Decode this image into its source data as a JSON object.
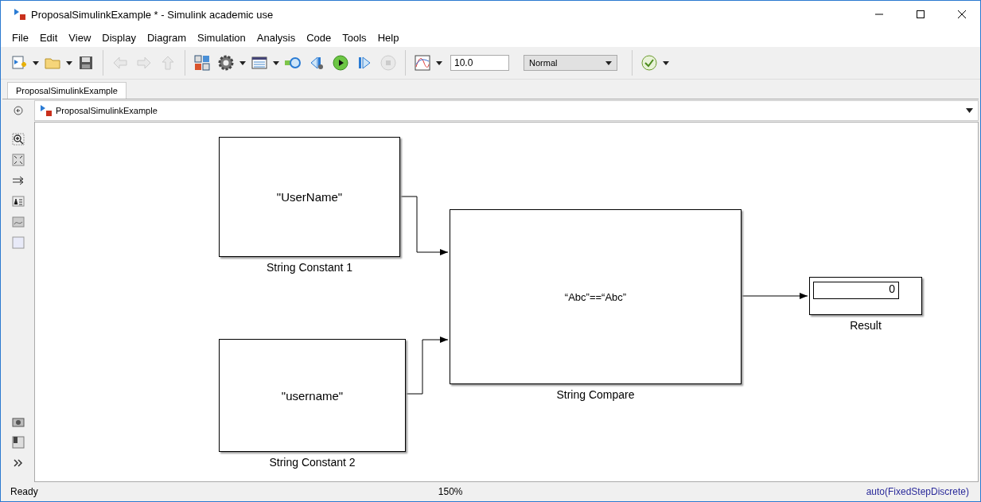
{
  "window": {
    "title": "ProposalSimulinkExample * - Simulink academic use"
  },
  "menu": [
    "File",
    "Edit",
    "View",
    "Display",
    "Diagram",
    "Simulation",
    "Analysis",
    "Code",
    "Tools",
    "Help"
  ],
  "toolbar": [
    {
      "kind": "new",
      "disabled": false
    },
    {
      "kind": "open",
      "disabled": false
    },
    {
      "kind": "save",
      "disabled": false
    },
    {
      "kind": "back",
      "disabled": true
    },
    {
      "kind": "forward",
      "disabled": true
    },
    {
      "kind": "up",
      "disabled": true
    },
    {
      "kind": "library",
      "disabled": false
    },
    {
      "kind": "settings",
      "disabled": false
    },
    {
      "kind": "explorer",
      "disabled": false
    },
    {
      "kind": "update",
      "disabled": false
    },
    {
      "kind": "stepback",
      "disabled": false
    },
    {
      "kind": "run",
      "disabled": false
    },
    {
      "kind": "stepforward",
      "disabled": false
    },
    {
      "kind": "stop",
      "disabled": true
    },
    {
      "kind": "scope",
      "disabled": false
    }
  ],
  "stop_time": "10.0",
  "sim_mode": "Normal",
  "tabs": [
    {
      "label": "ProposalSimulinkExample",
      "selected": true
    }
  ],
  "breadcrumb": "ProposalSimulinkExample",
  "palette": [
    {
      "kind": "zoom"
    },
    {
      "kind": "fit"
    },
    {
      "kind": "arrows"
    },
    {
      "kind": "annotation"
    },
    {
      "kind": "image"
    },
    {
      "kind": "area"
    }
  ],
  "palette_bottom": [
    {
      "kind": "camera"
    },
    {
      "kind": "properties"
    },
    {
      "kind": "more"
    }
  ],
  "blocks": [
    {
      "kind": "constant",
      "text": "\"UserName\"",
      "label": "String Constant 1"
    },
    {
      "kind": "constant",
      "text": "\"username\"",
      "label": "String Constant 2"
    },
    {
      "kind": "compare",
      "text": "“Abc”==“Abc”",
      "label": "String Compare"
    },
    {
      "kind": "display",
      "text": "0",
      "label": "Result"
    }
  ],
  "status": {
    "left": "Ready",
    "zoom": "150%",
    "solver": "auto(FixedStepDiscrete)"
  }
}
